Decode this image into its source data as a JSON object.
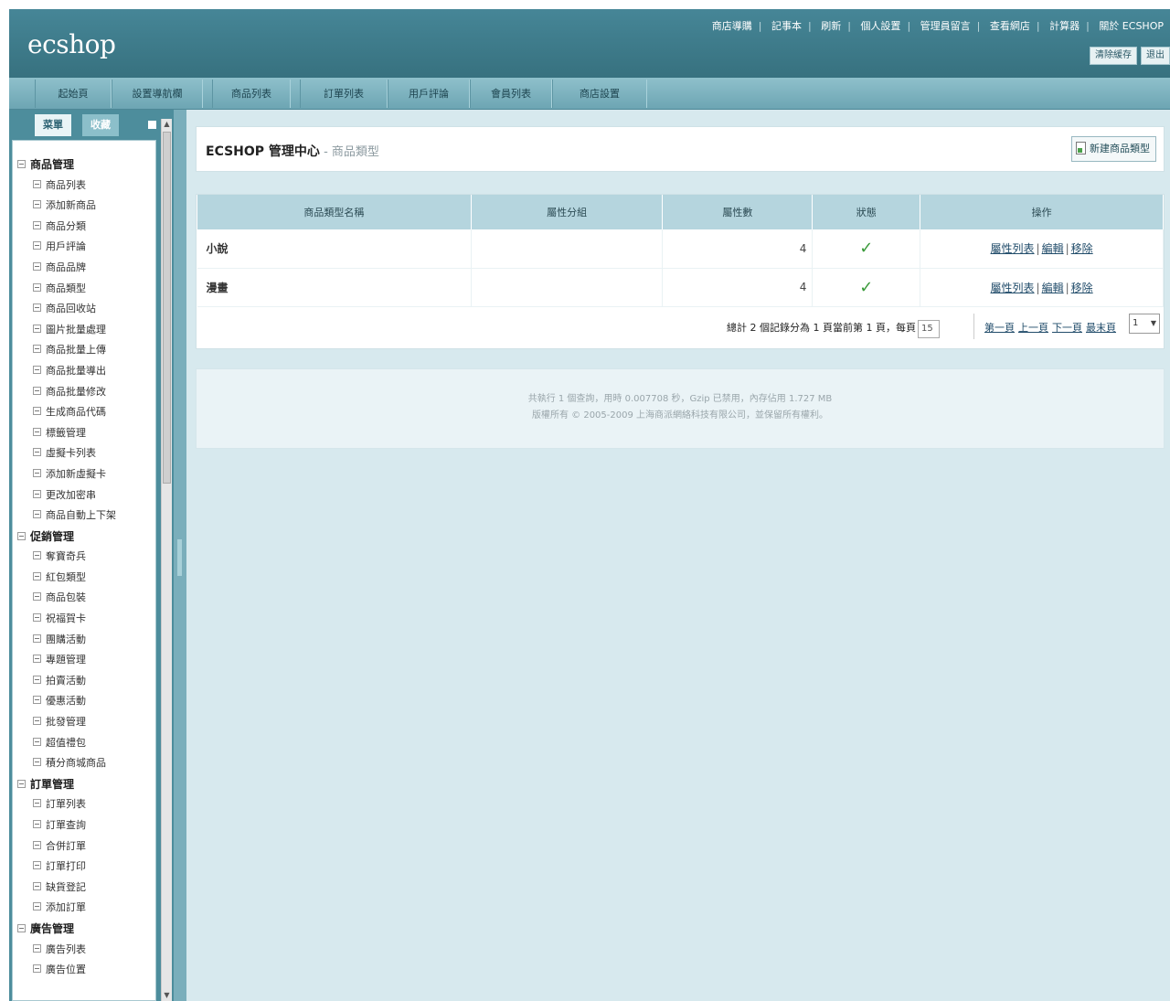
{
  "header": {
    "logo": "ecshop",
    "top_links": [
      "商店導購",
      "記事本",
      "刷新",
      "個人設置",
      "管理員留言",
      "查看網店",
      "計算器",
      "關於 ECSHOP"
    ],
    "buttons": [
      "清除緩存",
      "退出"
    ]
  },
  "nav": {
    "tabs": [
      "起始頁",
      "設置導航欄",
      "商品列表",
      "訂單列表",
      "用戶評論",
      "會員列表",
      "商店設置"
    ]
  },
  "sidebar": {
    "tab_menu": "菜單",
    "tab_favorites": "收藏",
    "groups": [
      {
        "label": "商品管理",
        "items": [
          "商品列表",
          "添加新商品",
          "商品分類",
          "用戶評論",
          "商品品牌",
          "商品類型",
          "商品回收站",
          "圖片批量處理",
          "商品批量上傳",
          "商品批量導出",
          "商品批量修改",
          "生成商品代碼",
          "標籤管理",
          "虛擬卡列表",
          "添加新虛擬卡",
          "更改加密串",
          "商品自動上下架"
        ]
      },
      {
        "label": "促銷管理",
        "items": [
          "奪寶奇兵",
          "紅包類型",
          "商品包裝",
          "祝福賀卡",
          "團購活動",
          "專題管理",
          "拍賣活動",
          "優惠活動",
          "批發管理",
          "超值禮包",
          "積分商城商品"
        ]
      },
      {
        "label": "訂單管理",
        "items": [
          "訂單列表",
          "訂單查詢",
          "合併訂單",
          "訂單打印",
          "缺貨登記",
          "添加訂單"
        ]
      },
      {
        "label": "廣告管理",
        "items": [
          "廣告列表",
          "廣告位置"
        ]
      }
    ]
  },
  "page": {
    "title": "ECSHOP 管理中心",
    "subtitle": " - 商品類型",
    "add_button": "新建商品類型"
  },
  "table": {
    "headers": [
      "商品類型名稱",
      "屬性分組",
      "屬性數",
      "狀態",
      "操作"
    ],
    "rows": [
      {
        "name": "小說",
        "group": "",
        "count": "4",
        "status": "✓",
        "ops": [
          "屬性列表",
          "編輯",
          "移除"
        ]
      },
      {
        "name": "漫畫",
        "group": "",
        "count": "4",
        "status": "✓",
        "ops": [
          "屬性列表",
          "編輯",
          "移除"
        ]
      }
    ]
  },
  "pager": {
    "info": "總計 2 個記錄分為 1 頁當前第 1 頁，每頁",
    "page_size": "15",
    "links": [
      "第一頁",
      "上一頁",
      "下一頁",
      "最末頁"
    ],
    "current_page": "1"
  },
  "footer": {
    "line1": "共執行 1 個查詢，用時 0.007708 秒，Gzip 已禁用，內存佔用 1.727 MB",
    "line2": "版權所有 © 2005-2009 上海商派網絡科技有限公司，並保留所有權利。"
  },
  "colors": {
    "header": "#3d7b8c",
    "nav": "#7fb3c0",
    "content_bg": "#d7e9ee",
    "table_header": "#b5d5de",
    "check": "#3a9a3a"
  }
}
